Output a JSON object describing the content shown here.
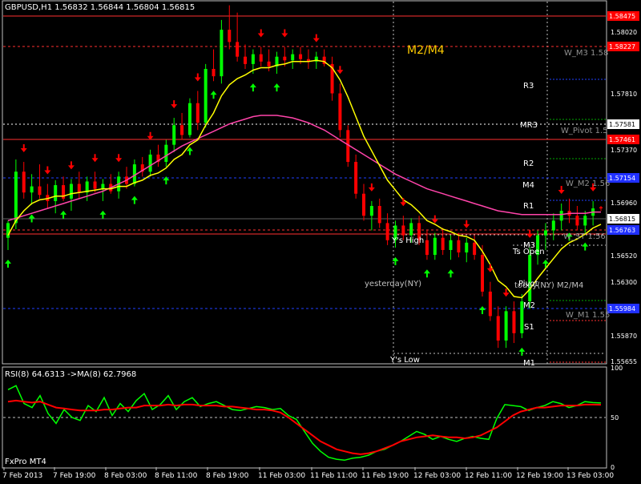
{
  "header": {
    "symbol_line": "GBPUSD,H1  1.56832 1.56844 1.56804 1.56815",
    "broker": "FxPro MT4"
  },
  "colors": {
    "background": "#000000",
    "frame": "#c0c0c0",
    "bull": "#00ff00",
    "bear": "#ff0000",
    "ema": "#ffff00",
    "ma": "#ff44aa",
    "rsi": "#00ff00",
    "rsi_ma": "#ff0000",
    "pivot_labels": "#ffffff",
    "yesterday_lines": "#c0c0c0",
    "price_box": "#ff0000",
    "blue_box": "#2030ff"
  },
  "chart_data": [
    {
      "type": "candlestick",
      "title": "GBPUSD,H1",
      "ylim": [
        1.5555,
        1.5851
      ],
      "price_ticks": [
        "1.58020",
        "1.57810",
        "1.57370",
        "1.56960",
        "1.56520",
        "1.56300",
        "1.55870",
        "1.55655"
      ],
      "x_ticks": [
        "7 Feb 2013",
        "7 Feb 19:00",
        "8 Feb 03:00",
        "8 Feb 11:00",
        "8 Feb 19:00",
        "11 Feb 03:00",
        "11 Feb 11:00",
        "11 Feb 19:00",
        "12 Feb 03:00",
        "12 Feb 11:00",
        "12 Feb 19:00",
        "13 Feb 03:00"
      ],
      "current_price": "1.56815",
      "current_value": 1.56815,
      "price_boxes": {
        "red_top": "1.58475",
        "red_2": "1.58227",
        "light_blue": "1.57581",
        "red_3": "1.57461",
        "blue_1": "1.57154",
        "blue_2": "1.56763",
        "blue_3": "1.55984"
      },
      "mm_header": "M2/M4",
      "pivot_labels": {
        "r3": "R3",
        "mr3": "MR3",
        "r2": "R2",
        "m4": "M4",
        "r1": "R1",
        "m3": "M3",
        "pivot": "Pivot",
        "m2": "M2",
        "s1": "S1",
        "m1": "M1"
      },
      "pivot_right_labels": {
        "w_m3": "W_M3 1.58",
        "w_pivot": "W_Pivot 1.5",
        "w_m2": "W_M2 1.56",
        "w_ast": "W_ST 1.56",
        "w_m1": "W_M1 1.55"
      },
      "text_labels": {
        "ys_high": "Y's High",
        "ys_open": "Ts Open",
        "ys_low": "Y's Low",
        "yesterday": "yesterday(NY)",
        "today": "today(NY) M2/M4"
      },
      "candles": [
        [
          1.5658,
          1.5672,
          1.5648,
          1.567
        ],
        [
          1.567,
          1.5722,
          1.5665,
          1.5712
        ],
        [
          1.5712,
          1.572,
          1.569,
          1.5695
        ],
        [
          1.5695,
          1.571,
          1.5685,
          1.57
        ],
        [
          1.57,
          1.5718,
          1.569,
          1.5693
        ],
        [
          1.5693,
          1.5702,
          1.5682,
          1.5688
        ],
        [
          1.5688,
          1.5705,
          1.5678,
          1.5701
        ],
        [
          1.5701,
          1.5708,
          1.5688,
          1.569
        ],
        [
          1.569,
          1.5706,
          1.568,
          1.5702
        ],
        [
          1.5702,
          1.5712,
          1.569,
          1.5695
        ],
        [
          1.5695,
          1.5708,
          1.5688,
          1.5704
        ],
        [
          1.5704,
          1.5712,
          1.5695,
          1.5698
        ],
        [
          1.5698,
          1.5706,
          1.5688,
          1.5702
        ],
        [
          1.5702,
          1.571,
          1.5694,
          1.5696
        ],
        [
          1.5696,
          1.5712,
          1.569,
          1.5708
        ],
        [
          1.5708,
          1.5716,
          1.5698,
          1.5702
        ],
        [
          1.5702,
          1.5722,
          1.57,
          1.5718
        ],
        [
          1.5718,
          1.5724,
          1.5708,
          1.5712
        ],
        [
          1.5712,
          1.573,
          1.5708,
          1.5726
        ],
        [
          1.5726,
          1.5734,
          1.5716,
          1.572
        ],
        [
          1.572,
          1.5738,
          1.5716,
          1.5734
        ],
        [
          1.5734,
          1.5756,
          1.5728,
          1.575
        ],
        [
          1.575,
          1.576,
          1.5738,
          1.5742
        ],
        [
          1.5742,
          1.5772,
          1.574,
          1.5768
        ],
        [
          1.5768,
          1.5778,
          1.5746,
          1.5752
        ],
        [
          1.5752,
          1.58,
          1.5748,
          1.5796
        ],
        [
          1.5796,
          1.5812,
          1.5786,
          1.579
        ],
        [
          1.579,
          1.5836,
          1.5784,
          1.5828
        ],
        [
          1.5828,
          1.5848,
          1.5812,
          1.5818
        ],
        [
          1.5818,
          1.5842,
          1.5802,
          1.5806
        ],
        [
          1.5806,
          1.5816,
          1.5796,
          1.58
        ],
        [
          1.58,
          1.5812,
          1.5792,
          1.5808
        ],
        [
          1.5808,
          1.5814,
          1.5798,
          1.5802
        ],
        [
          1.5802,
          1.5812,
          1.5794,
          1.5798
        ],
        [
          1.5798,
          1.581,
          1.5792,
          1.5806
        ],
        [
          1.5806,
          1.5814,
          1.5798,
          1.5803
        ],
        [
          1.5803,
          1.5812,
          1.5796,
          1.5808
        ],
        [
          1.5808,
          1.5814,
          1.58,
          1.5804
        ],
        [
          1.5804,
          1.5812,
          1.5796,
          1.5802
        ],
        [
          1.5802,
          1.581,
          1.5796,
          1.5806
        ],
        [
          1.5806,
          1.5812,
          1.5798,
          1.58
        ],
        [
          1.58,
          1.5806,
          1.577,
          1.5776
        ],
        [
          1.5776,
          1.5784,
          1.574,
          1.5746
        ],
        [
          1.5746,
          1.575,
          1.5716,
          1.572
        ],
        [
          1.572,
          1.5726,
          1.569,
          1.5694
        ],
        [
          1.5694,
          1.5702,
          1.5672,
          1.5676
        ],
        [
          1.5676,
          1.5688,
          1.5664,
          1.5684
        ],
        [
          1.5684,
          1.569,
          1.5666,
          1.567
        ],
        [
          1.567,
          1.5678,
          1.5652,
          1.5656
        ],
        [
          1.5656,
          1.5672,
          1.565,
          1.5668
        ],
        [
          1.5668,
          1.5676,
          1.5656,
          1.566
        ],
        [
          1.566,
          1.5674,
          1.5654,
          1.567
        ],
        [
          1.567,
          1.5676,
          1.5652,
          1.5656
        ],
        [
          1.5656,
          1.5664,
          1.564,
          1.5644
        ],
        [
          1.5644,
          1.5662,
          1.564,
          1.5658
        ],
        [
          1.5658,
          1.5666,
          1.5644,
          1.5648
        ],
        [
          1.5648,
          1.566,
          1.564,
          1.5656
        ],
        [
          1.5656,
          1.5662,
          1.5642,
          1.5646
        ],
        [
          1.5646,
          1.5658,
          1.5638,
          1.5654
        ],
        [
          1.5654,
          1.566,
          1.564,
          1.5644
        ],
        [
          1.5644,
          1.5652,
          1.561,
          1.5614
        ],
        [
          1.5614,
          1.5622,
          1.559,
          1.5594
        ],
        [
          1.5594,
          1.5602,
          1.5568,
          1.5574
        ],
        [
          1.5574,
          1.5602,
          1.5568,
          1.5598
        ],
        [
          1.5598,
          1.5606,
          1.5572,
          1.558
        ],
        [
          1.558,
          1.5612,
          1.5576,
          1.5606
        ],
        [
          1.5606,
          1.565,
          1.56,
          1.5644
        ],
        [
          1.5644,
          1.5664,
          1.5636,
          1.566
        ],
        [
          1.566,
          1.567,
          1.5648,
          1.5664
        ],
        [
          1.5664,
          1.5678,
          1.5656,
          1.5672
        ],
        [
          1.5672,
          1.5686,
          1.5664,
          1.568
        ],
        [
          1.568,
          1.569,
          1.567,
          1.5676
        ],
        [
          1.5676,
          1.5684,
          1.5664,
          1.5668
        ],
        [
          1.5668,
          1.568,
          1.5662,
          1.5676
        ],
        [
          1.5676,
          1.5688,
          1.5668,
          1.5682
        ],
        [
          1.5683,
          1.5684,
          1.568,
          1.5682
        ]
      ],
      "ema_values": [
        1.566,
        1.5672,
        1.568,
        1.5686,
        1.5689,
        1.569,
        1.5692,
        1.5692,
        1.5694,
        1.5695,
        1.5696,
        1.5697,
        1.5698,
        1.5698,
        1.57,
        1.57,
        1.5703,
        1.5705,
        1.5709,
        1.5711,
        1.5715,
        1.5722,
        1.5726,
        1.5734,
        1.5738,
        1.575,
        1.576,
        1.5774,
        1.5783,
        1.5788,
        1.5791,
        1.5795,
        1.5797,
        1.5797,
        1.5799,
        1.58,
        1.5802,
        1.5802,
        1.5802,
        1.5803,
        1.5802,
        1.5797,
        1.5787,
        1.5773,
        1.5757,
        1.5741,
        1.5729,
        1.5717,
        1.5705,
        1.5697,
        1.5689,
        1.5685,
        1.5679,
        1.5672,
        1.5669,
        1.5665,
        1.5663,
        1.566,
        1.5659,
        1.5656,
        1.5647,
        1.5636,
        1.5623,
        1.5618,
        1.561,
        1.5609,
        1.5616,
        1.5625,
        1.5633,
        1.5641,
        1.5649,
        1.5654,
        1.5657,
        1.5661,
        1.5666,
        1.5669
      ],
      "ma_values": [
        1.5672,
        1.5674,
        1.5676,
        1.5678,
        1.568,
        1.5682,
        1.5684,
        1.5686,
        1.5688,
        1.569,
        1.5692,
        1.5694,
        1.5696,
        1.5699,
        1.5702,
        1.5705,
        1.5709,
        1.5713,
        1.5717,
        1.5721,
        1.5725,
        1.5729,
        1.5733,
        1.5736,
        1.5739,
        1.5742,
        1.5745,
        1.5748,
        1.5751,
        1.5753,
        1.5755,
        1.5757,
        1.5758,
        1.5758,
        1.5758,
        1.5757,
        1.5756,
        1.5754,
        1.5752,
        1.5749,
        1.5746,
        1.5742,
        1.5738,
        1.5734,
        1.573,
        1.5726,
        1.5722,
        1.5718,
        1.5714,
        1.571,
        1.5707,
        1.5704,
        1.5701,
        1.5698,
        1.5696,
        1.5694,
        1.5692,
        1.569,
        1.5688,
        1.5686,
        1.5684,
        1.5682,
        1.568,
        1.5679,
        1.5678,
        1.5677,
        1.5677,
        1.5677,
        1.5677,
        1.5677,
        1.5677,
        1.5678,
        1.5678,
        1.5678,
        1.5679,
        1.5679
      ],
      "buy_arrows": [
        0,
        3,
        7,
        12,
        16,
        20,
        23,
        26,
        31,
        34,
        49,
        53,
        56,
        60,
        65,
        68,
        71,
        73
      ],
      "sell_arrows": [
        2,
        5,
        8,
        11,
        14,
        18,
        21,
        24,
        28,
        32,
        35,
        39,
        42,
        46,
        50,
        54,
        58,
        61,
        63,
        66,
        70,
        74
      ]
    },
    {
      "type": "line",
      "title": "RSI(8) 64.6313  ->MA(8) 62.7968",
      "ylim": [
        0,
        100
      ],
      "y_ticks": [
        "100",
        "50",
        "0"
      ],
      "levels": [
        70,
        30
      ],
      "series": [
        {
          "name": "RSI(8) 64.6313",
          "values": [
            78,
            82,
            64,
            60,
            72,
            54,
            44,
            58,
            50,
            47,
            62,
            56,
            70,
            52,
            64,
            56,
            67,
            74,
            58,
            63,
            72,
            58,
            66,
            70,
            61,
            64,
            66,
            62,
            58,
            57,
            59,
            61,
            60,
            58,
            59,
            52,
            48,
            36,
            24,
            16,
            10,
            8,
            7,
            9,
            10,
            12,
            16,
            18,
            22,
            26,
            31,
            36,
            33,
            28,
            31,
            28,
            26,
            29,
            31,
            29,
            28,
            49,
            63,
            62,
            61,
            57,
            60,
            62,
            66,
            64,
            60,
            62,
            66,
            65,
            64.6
          ]
        },
        {
          "name": "MA(8) 62.7968",
          "values": [
            66,
            67,
            66,
            65,
            66,
            63,
            60,
            59,
            58,
            57,
            57,
            57,
            58,
            58,
            59,
            60,
            60,
            62,
            62,
            62,
            63,
            62,
            63,
            63,
            62,
            62,
            62,
            61,
            61,
            60,
            59,
            58,
            58,
            57,
            55,
            50,
            44,
            38,
            32,
            26,
            22,
            18,
            16,
            14,
            13,
            14,
            16,
            19,
            22,
            26,
            28,
            30,
            31,
            32,
            31,
            30,
            30,
            29,
            30,
            32,
            36,
            40,
            46,
            52,
            56,
            58,
            60,
            60,
            61,
            62,
            62,
            62,
            63,
            63,
            62.8
          ]
        }
      ]
    }
  ]
}
